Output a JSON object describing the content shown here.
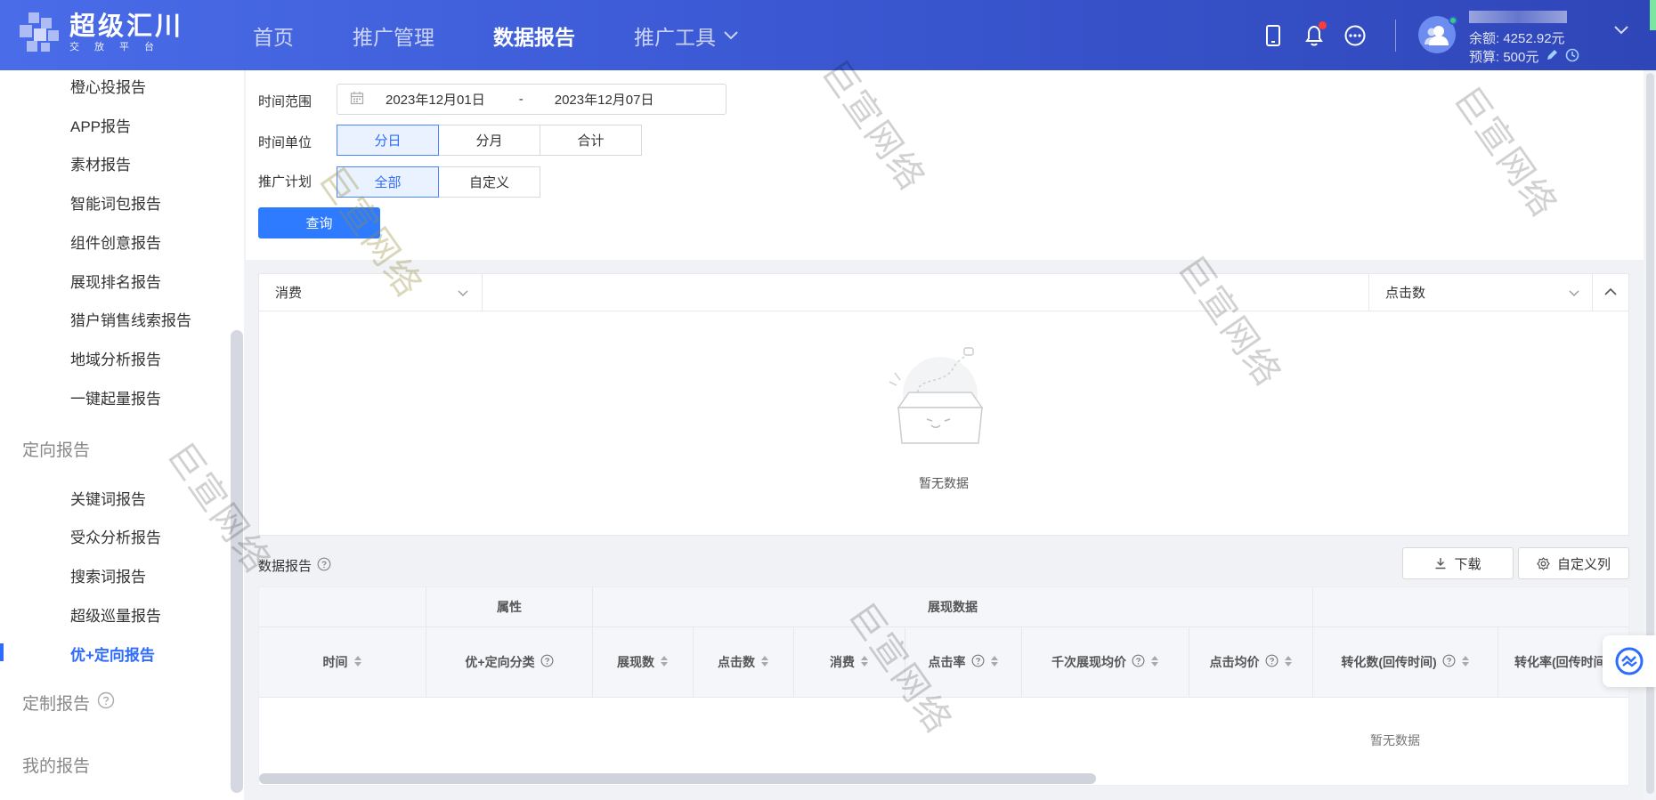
{
  "app": {
    "logo_title": "超级汇川",
    "logo_sub": "交放平台"
  },
  "nav": [
    {
      "label": "首页"
    },
    {
      "label": "推广管理"
    },
    {
      "label": "数据报告"
    },
    {
      "label": "推广工具"
    }
  ],
  "account": {
    "balance": "余额: 4252.92元",
    "budget": "预算: 500元"
  },
  "sidebar": {
    "items": [
      {
        "label": "橙心投报告"
      },
      {
        "label": "APP报告"
      },
      {
        "label": "素材报告"
      },
      {
        "label": "智能词包报告"
      },
      {
        "label": "组件创意报告"
      },
      {
        "label": "展现排名报告"
      },
      {
        "label": "猎户销售线索报告"
      },
      {
        "label": "地域分析报告"
      },
      {
        "label": "一键起量报告"
      }
    ],
    "group_targeting": "定向报告",
    "targeting_items": [
      {
        "label": "关键词报告"
      },
      {
        "label": "受众分析报告"
      },
      {
        "label": "搜索词报告"
      },
      {
        "label": "超级巡量报告"
      },
      {
        "label": "优+定向报告"
      }
    ],
    "group_custom": "定制报告",
    "group_mine": "我的报告"
  },
  "filters": {
    "time_range_label": "时间范围",
    "date_start": "2023年12月01日",
    "date_sep": "-",
    "date_end": "2023年12月07日",
    "time_unit_label": "时间单位",
    "time_units": [
      "分日",
      "分月",
      "合计"
    ],
    "plan_label": "推广计划",
    "plan_options": [
      "全部",
      "自定义"
    ],
    "query_button": "查询"
  },
  "chart": {
    "left_metric": "消费",
    "right_metric": "点击数",
    "empty_text": "暂无数据"
  },
  "report": {
    "title": "数据报告",
    "download_button": "下载",
    "custom_columns_button": "自定义列",
    "group_headers": [
      "属性",
      "展现数据"
    ],
    "columns": [
      "时间",
      "优+定向分类",
      "展现数",
      "点击数",
      "消费",
      "点击率",
      "千次展现均价",
      "点击均价",
      "转化数(回传时间)",
      "转化率(回传时间"
    ],
    "empty_text": "暂无数据"
  },
  "watermark": "巨宣网络",
  "colors": {
    "accent": "#2f6bff",
    "topbar": "#3d5bd6"
  }
}
